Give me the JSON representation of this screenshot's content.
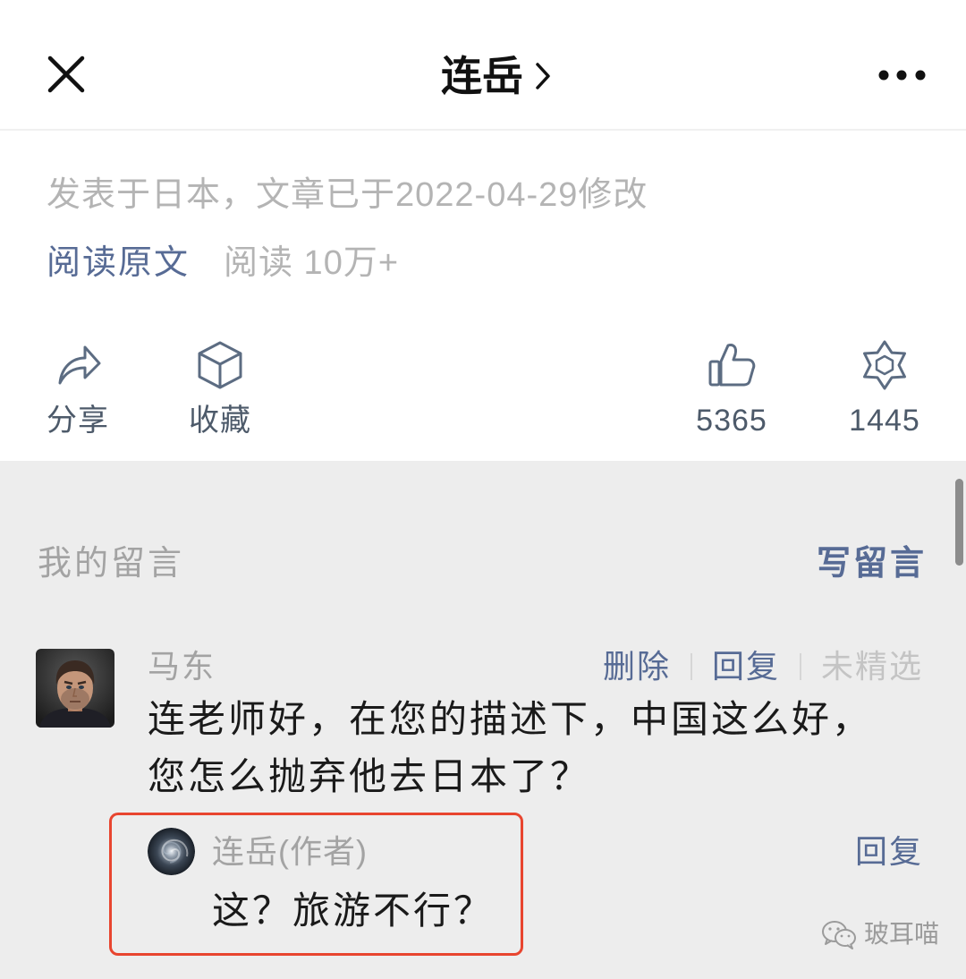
{
  "header": {
    "title": "连岳",
    "close_icon": "close-icon",
    "chevron_icon": "chevron-right-icon",
    "more_icon": "more-icon"
  },
  "article_meta": {
    "publish_info": "发表于日本，文章已于2022-04-29修改",
    "read_original": "阅读原文",
    "read_count": "阅读 10万+"
  },
  "actions": {
    "share": {
      "label": "分享",
      "icon": "share-icon"
    },
    "collect": {
      "label": "收藏",
      "icon": "cube-icon"
    },
    "like": {
      "count": "5365",
      "icon": "thumbs-up-icon"
    },
    "wow": {
      "count": "1445",
      "icon": "star-icon"
    }
  },
  "comments": {
    "section_title": "我的留言",
    "write_comment": "写留言",
    "items": [
      {
        "author": "马东",
        "actions": {
          "delete": "删除",
          "reply": "回复",
          "status": "未精选"
        },
        "text_lines": [
          "连老师好，在您的描述下，中国这么好，",
          "您怎么抛弃他去日本了？"
        ],
        "author_reply": {
          "author": "连岳(作者)",
          "text": "这？旅游不行？",
          "reply_label": "回复"
        }
      }
    ]
  },
  "watermark": {
    "text": "玻耳喵",
    "icon": "wechat-icon"
  },
  "colors": {
    "link": "#576b95",
    "meta_text": "#b4b4b4",
    "body_text": "#1a1a1a",
    "secondary_text": "#a3a3a3",
    "disabled_text": "#c4c4c4",
    "icon_stroke": "#5c6c82",
    "page_bg": "#ededed",
    "card_bg": "#ffffff",
    "highlight_border": "#e8452f"
  }
}
